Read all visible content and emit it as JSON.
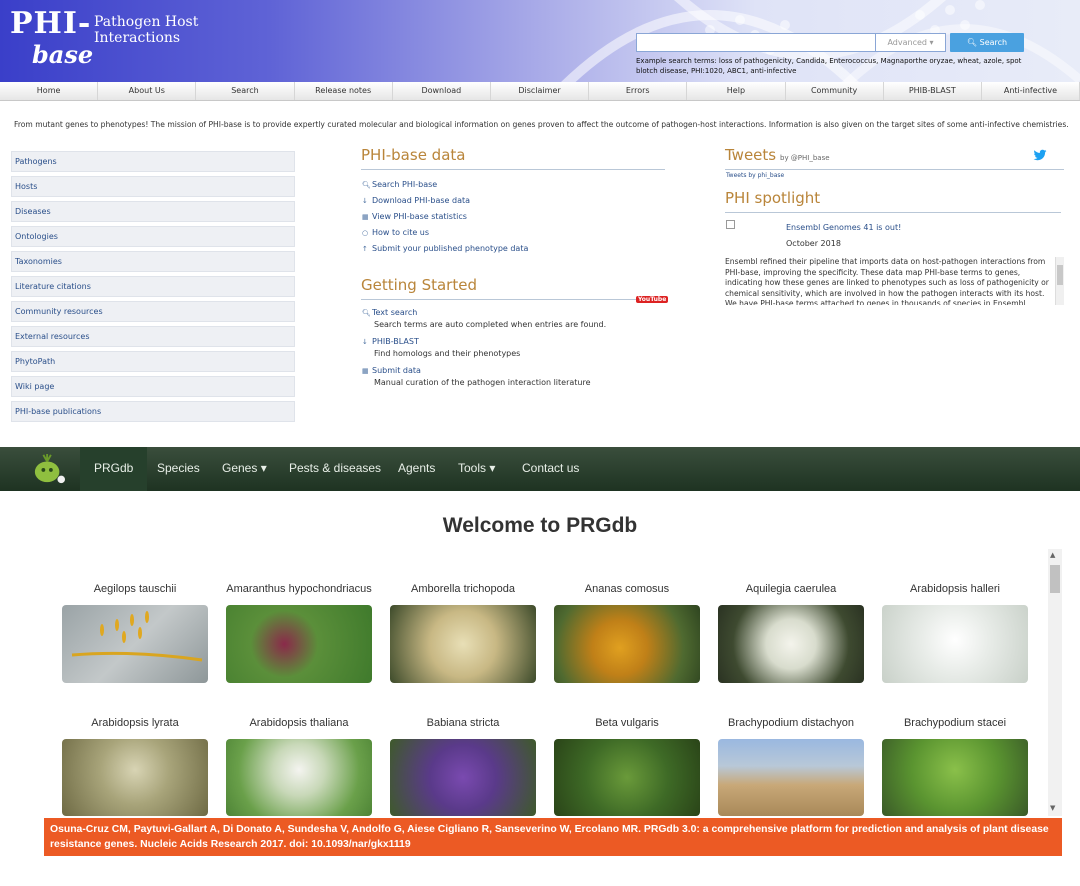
{
  "phi": {
    "logo": {
      "line1": "PHI-",
      "line2": "base",
      "tagline": "Pathogen Host Interactions"
    },
    "search": {
      "placeholder": "",
      "advanced_label": "Advanced ▾",
      "button_label": "Search",
      "hint": "Example search terms: loss of pathogenicity, Candida, Enterococcus, Magnaporthe oryzae, wheat, azole, spot blotch disease, PHI:1020, ABC1, anti-infective"
    },
    "nav": [
      "Home",
      "About Us",
      "Search",
      "Release notes",
      "Download",
      "Disclaimer",
      "Errors",
      "Help",
      "Community",
      "PHIB-BLAST",
      "Anti-infective"
    ],
    "mission": "From mutant genes to phenotypes! The mission of PHI-base is to provide expertly curated molecular and biological information on genes proven to affect the outcome of pathogen-host interactions. Information is also given on the target sites of some anti-infective chemistries.",
    "sidebar": [
      "Pathogens",
      "Hosts",
      "Diseases",
      "Ontologies",
      "Taxonomies",
      "Literature citations",
      "Community resources",
      "External resources",
      "PhytoPath",
      "Wiki page",
      "PHI-base publications"
    ],
    "data_section": {
      "title": "PHI-base data",
      "links": [
        {
          "icon": "search-icon",
          "label": "Search PHI-base"
        },
        {
          "icon": "download-icon",
          "label": "Download PHI-base data"
        },
        {
          "icon": "chart-icon",
          "label": "View PHI-base statistics"
        },
        {
          "icon": "cite-icon",
          "label": "How to cite us"
        },
        {
          "icon": "upload-icon",
          "label": "Submit your published phenotype data"
        }
      ]
    },
    "getting_started": {
      "title": "Getting Started",
      "youtube": "YouTube",
      "items": [
        {
          "icon": "search-icon",
          "label": "Text search",
          "desc": "Search terms are auto completed when entries are found."
        },
        {
          "icon": "download-icon",
          "label": "PHIB-BLAST",
          "desc": "Find homologs and their phenotypes"
        },
        {
          "icon": "chart-icon",
          "label": "Submit data",
          "desc": "Manual curation of the pathogen interaction literature"
        }
      ]
    },
    "tweets": {
      "title": "Tweets",
      "by": "by @PHI_base",
      "small": "Tweets by phi_base"
    },
    "spotlight": {
      "title": "PHI spotlight",
      "item_title": "Ensembl Genomes 41 is out!",
      "date": "October 2018",
      "body": "Ensembl refined their pipeline that imports data on host-pathogen interactions from PHI-base, improving the specificity. These data map PHI-base terms to genes, indicating how these genes are linked to phenotypes such as loss of pathogenicity or chemical sensitivity, which are involved in how the pathogen interacts with its host. We have PHI-base terms attached to genes in thousands of species in Ensembl Bacteria"
    }
  },
  "prg": {
    "nav": {
      "brand": "PRGdb",
      "species": "Species",
      "genes": "Genes ▾",
      "pests": "Pests & diseases",
      "agents": "Agents",
      "tools": "Tools ▾",
      "contact": "Contact us"
    },
    "welcome": "Welcome to PRGdb",
    "species": [
      "Aegilops tauschii",
      "Amaranthus hypochondriacus",
      "Amborella trichopoda",
      "Ananas comosus",
      "Aquilegia caerulea",
      "Arabidopsis halleri",
      "Arabidopsis lyrata",
      "Arabidopsis thaliana",
      "Babiana stricta",
      "Beta vulgaris",
      "Brachypodium distachyon",
      "Brachypodium stacei"
    ],
    "citation": "Osuna-Cruz CM, Paytuvi-Gallart A, Di Donato A, Sundesha V, Andolfo G, Aiese Cigliano R, Sanseverino W, Ercolano MR. PRGdb 3.0: a comprehensive platform for prediction and analysis of plant disease resistance genes. Nucleic Acids Research 2017. doi: 10.1093/nar/gkx1119"
  },
  "colors": {
    "phi_blue": "#3a3fc9",
    "section_title": "#b9853a",
    "prg_nav": "#1e3322",
    "citation_bg": "#ec5a24"
  }
}
